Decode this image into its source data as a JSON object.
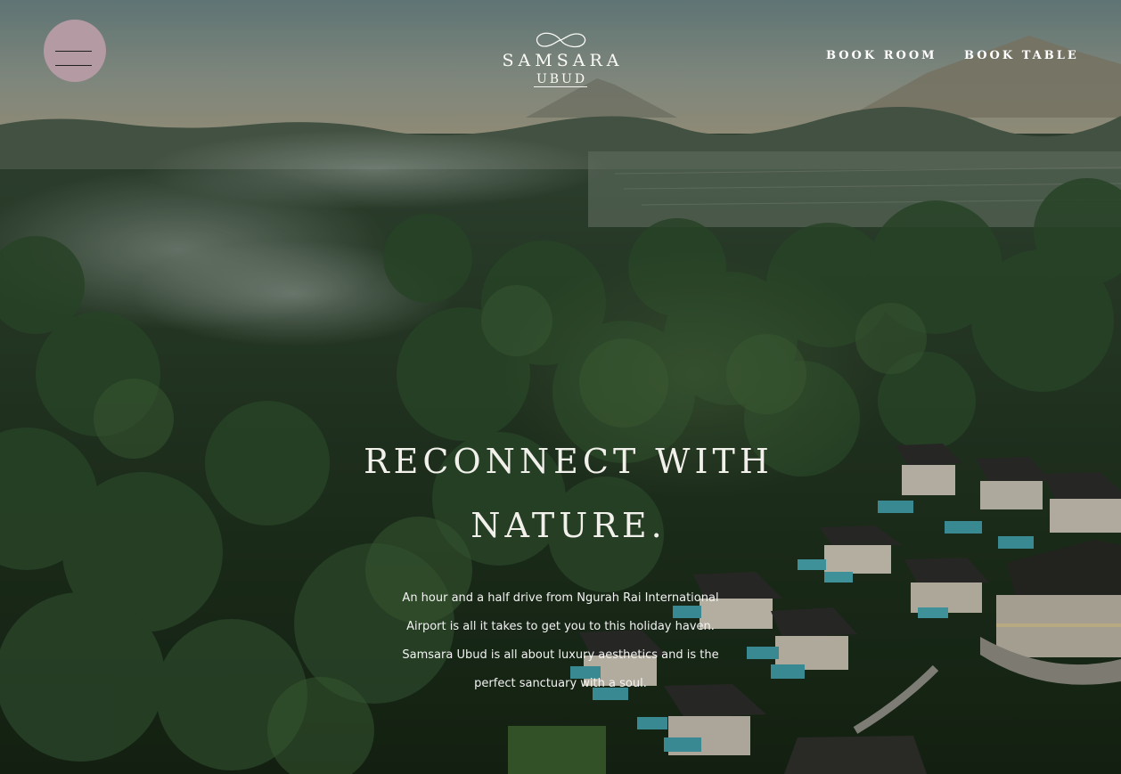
{
  "brand": {
    "name": "SAMSARA",
    "sub": "UBUD"
  },
  "header": {
    "menu_icon": "hamburger-icon",
    "nav": [
      {
        "label": "BOOK ROOM"
      },
      {
        "label": "BOOK TABLE"
      }
    ]
  },
  "hero": {
    "headline": "RECONNECT WITH NATURE.",
    "intro": "An hour and a half drive from Ngurah Rai International Airport is all it takes to get you to this holiday haven. Samsara Ubud is all about luxury aesthetics and is the perfect sanctuary with a soul."
  },
  "colors": {
    "menu_button": "#b39aa3",
    "text": "#ffffff"
  }
}
